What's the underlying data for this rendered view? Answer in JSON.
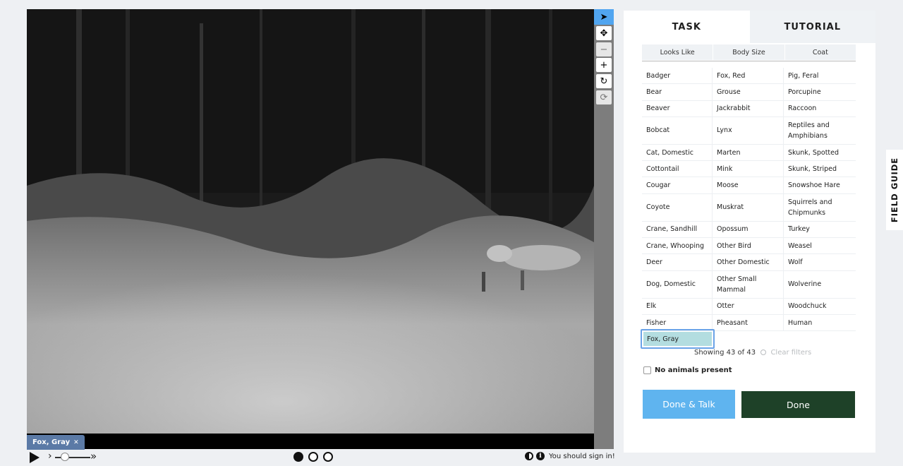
{
  "viewer": {
    "selected_annotation": "Fox, Gray",
    "remove_icon": "close-icon",
    "frames": [
      {
        "active": true
      },
      {
        "active": false
      },
      {
        "active": false
      }
    ],
    "signin_text": "You should sign in!"
  },
  "toolbar": {
    "tools": [
      "pointer-icon",
      "move-icon",
      "zoom-out-icon",
      "zoom-in-icon",
      "rotate-icon",
      "reset-icon"
    ]
  },
  "tabs": {
    "task": "TASK",
    "tutorial": "TUTORIAL"
  },
  "filters": {
    "looks_like": "Looks Like",
    "body_size": "Body Size",
    "coat": "Coat"
  },
  "species": [
    "Badger",
    "Fox, Red",
    "Pig, Feral",
    "Bear",
    "Grouse",
    "Porcupine",
    "Beaver",
    "Jackrabbit",
    "Raccoon",
    "Bobcat",
    "Lynx",
    "Reptiles and Amphibians",
    "Cat, Domestic",
    "Marten",
    "Skunk, Spotted",
    "Cottontail",
    "Mink",
    "Skunk, Striped",
    "Cougar",
    "Moose",
    "Snowshoe Hare",
    "Coyote",
    "Muskrat",
    "Squirrels and Chipmunks",
    "Crane, Sandhill",
    "Opossum",
    "Turkey",
    "Crane, Whooping",
    "Other Bird",
    "Weasel",
    "Deer",
    "Other Domestic",
    "Wolf",
    "Dog, Domestic",
    "Other Small Mammal",
    "Wolverine",
    "Elk",
    "Otter",
    "Woodchuck",
    "Fisher",
    "Pheasant",
    "Human"
  ],
  "selected_choice": "Fox, Gray",
  "showing": "Showing 43 of 43",
  "clear_filters": "Clear filters",
  "no_animals": "No animals present",
  "done_talk": "Done & Talk",
  "done": "Done",
  "field_guide": "FIELD GUIDE"
}
